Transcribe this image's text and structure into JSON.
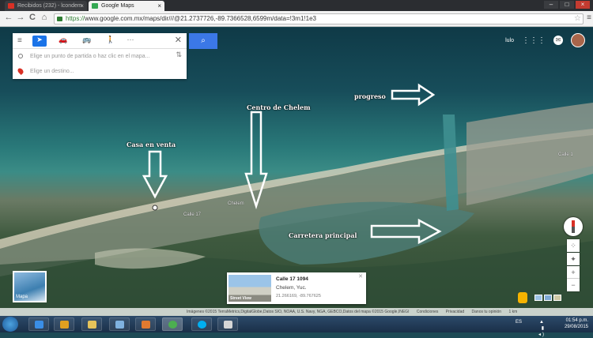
{
  "browser": {
    "tabs": [
      {
        "label": "Recibidos (232) - lcondem",
        "icon": "gmail-icon",
        "color": "#d93025"
      },
      {
        "label": "Google Maps",
        "icon": "maps-icon",
        "color": "#34a853"
      }
    ],
    "nav": {
      "back": "←",
      "forward": "→",
      "reload": "C",
      "home": "⌂"
    },
    "url_scheme": "https://",
    "url_rest": "www.google.com.mx/maps/dir///@21.2737726,-89.7366528,6599m/data=!3m1!1e3",
    "star": "☆",
    "menu": "≡"
  },
  "directions": {
    "modes": [
      "➤",
      "🚗",
      "🚌",
      "🚶",
      "···"
    ],
    "origin_placeholder": "Elige un punto de partida o haz clic en el mapa...",
    "destination_placeholder": "Elige un destino...",
    "swap": "⇅",
    "close": "✕",
    "menu": "≡"
  },
  "header": {
    "user": "lulo",
    "apps": "⋮⋮⋮",
    "notifications": "✉"
  },
  "annotations": {
    "progreso": "progreso",
    "centro": "Centro de Chelem",
    "casa": "Casa en venta",
    "carretera": "Carretera principal"
  },
  "map_labels": {
    "chelem": "Chelem",
    "calle1": "Calle 1",
    "calle17": "Calle 17"
  },
  "thumbnail": {
    "label": "Mapa"
  },
  "street_card": {
    "badge": "Street View",
    "title": "Calle 17 1094",
    "subtitle": "Chelem, Yuc.",
    "coords": "21.266169, -89.767625",
    "close": "✕"
  },
  "controls": {
    "zoom_in": "+",
    "zoom_out": "−",
    "locate": "◉",
    "tilt": "✦",
    "grid": "⁘"
  },
  "attribution": [
    "Imágenes ©2015 TerraMetrics,DigitalGlobe,Datos SIO, NOAA, U.S. Navy, NGA, GEBCO,Datos del mapa ©2015 Google,INEGI",
    "Condiciones",
    "Privacidad",
    "Danos tu opinión",
    "1 km"
  ],
  "taskbar": {
    "apps": [
      {
        "icon": "ie-icon",
        "color": "#3a8ee6"
      },
      {
        "icon": "media-icon",
        "color": "#e0a020"
      },
      {
        "icon": "folder-icon",
        "color": "#e6c35a"
      },
      {
        "icon": "photo-icon",
        "color": "#7fb2e0"
      },
      {
        "icon": "player-icon",
        "color": "#e07a30"
      },
      {
        "icon": "chrome-icon",
        "color": "#4caf50"
      },
      {
        "icon": "skype-icon",
        "color": "#00aff0"
      },
      {
        "icon": "paint-icon",
        "color": "#d6d6d6"
      }
    ],
    "language": "ES",
    "time": "01:54 p.m.",
    "date": "29/08/2015"
  }
}
